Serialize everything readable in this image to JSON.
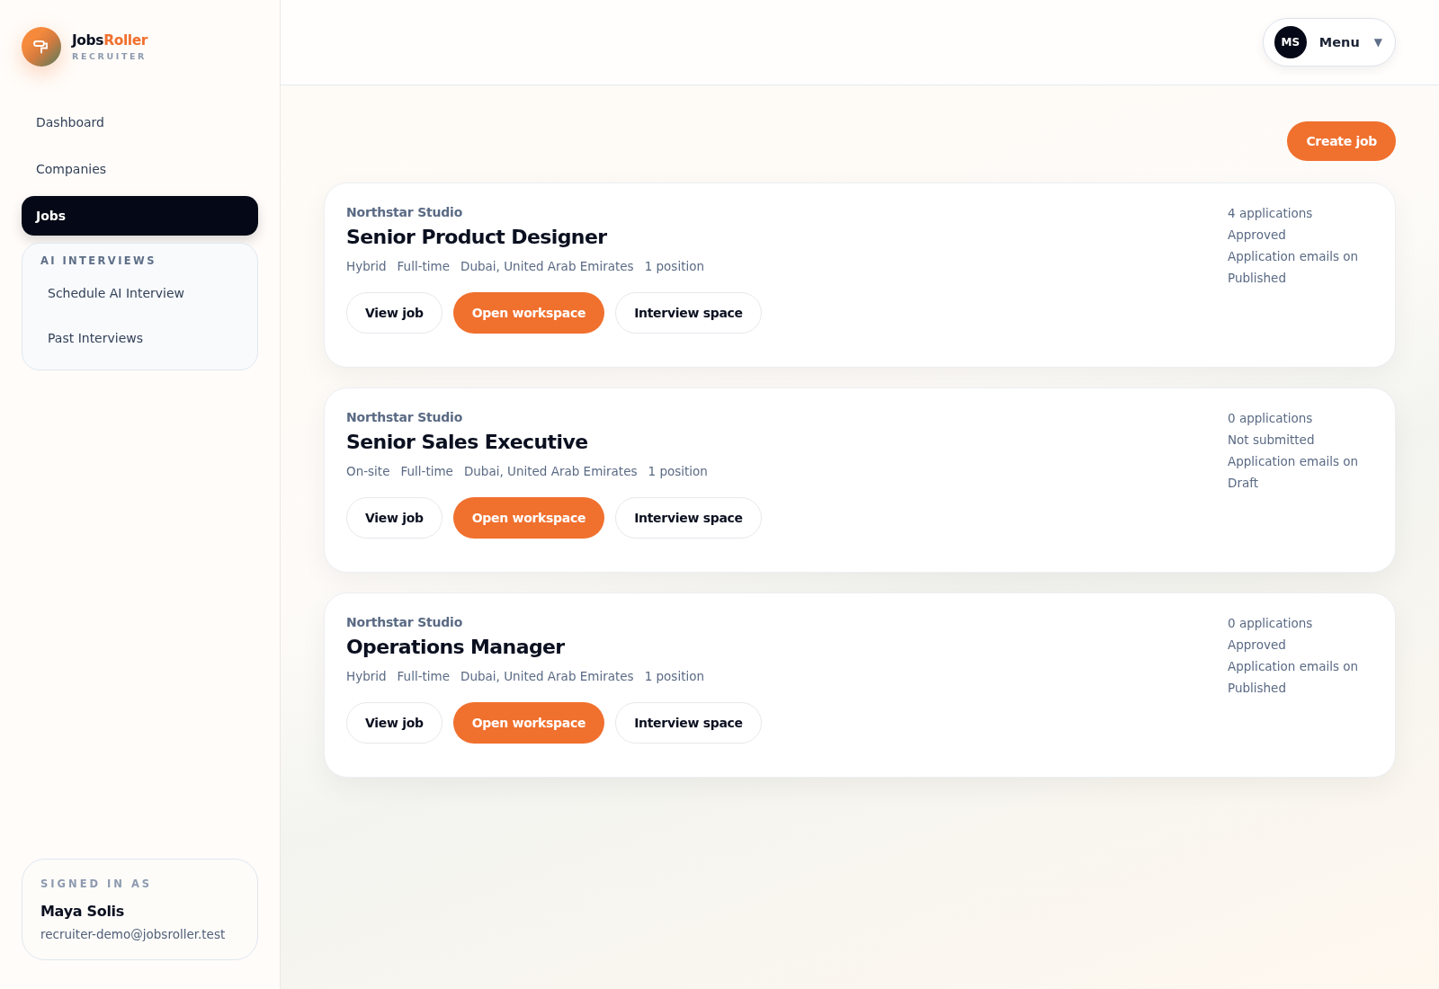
{
  "brand": {
    "name_dark": "Jobs",
    "name_accent": "Roller",
    "tagline": "RECRUITER"
  },
  "sidebar": {
    "items": [
      {
        "label": "Dashboard",
        "selected": false
      },
      {
        "label": "Companies",
        "selected": false
      },
      {
        "label": "Jobs",
        "selected": true
      }
    ],
    "group": {
      "title": "AI INTERVIEWS",
      "items": [
        {
          "label": "Schedule AI Interview",
          "selected": false
        },
        {
          "label": "Past Interviews",
          "selected": false
        }
      ]
    },
    "account": {
      "caption": "SIGNED IN AS",
      "name": "Maya Solis",
      "email": "recruiter-demo@jobsroller.test"
    }
  },
  "header": {
    "avatar": "MS",
    "menu": "Menu",
    "caret": "▼"
  },
  "create_button": "Create job",
  "jobs": [
    {
      "company": "Northstar Studio",
      "title": "Senior Product Designer",
      "meta": [
        "Hybrid",
        "Full-time",
        "Dubai, United Arab Emirates",
        "1 position"
      ],
      "stats": [
        "4 applications",
        "Approved",
        "Application emails on",
        "Published"
      ],
      "actions": [
        "View job",
        "Open workspace",
        "Interview space"
      ]
    },
    {
      "company": "Northstar Studio",
      "title": "Senior Sales Executive",
      "meta": [
        "On-site",
        "Full-time",
        "Dubai, United Arab Emirates",
        "1 position"
      ],
      "stats": [
        "0 applications",
        "Not submitted",
        "Application emails on",
        "Draft"
      ],
      "actions": [
        "View job",
        "Open workspace",
        "Interview space"
      ]
    },
    {
      "company": "Northstar Studio",
      "title": "Operations Manager",
      "meta": [
        "Hybrid",
        "Full-time",
        "Dubai, United Arab Emirates",
        "1 position"
      ],
      "stats": [
        "0 applications",
        "Approved",
        "Application emails on",
        "Published"
      ],
      "actions": [
        "View job",
        "Open workspace",
        "Interview space"
      ]
    }
  ]
}
